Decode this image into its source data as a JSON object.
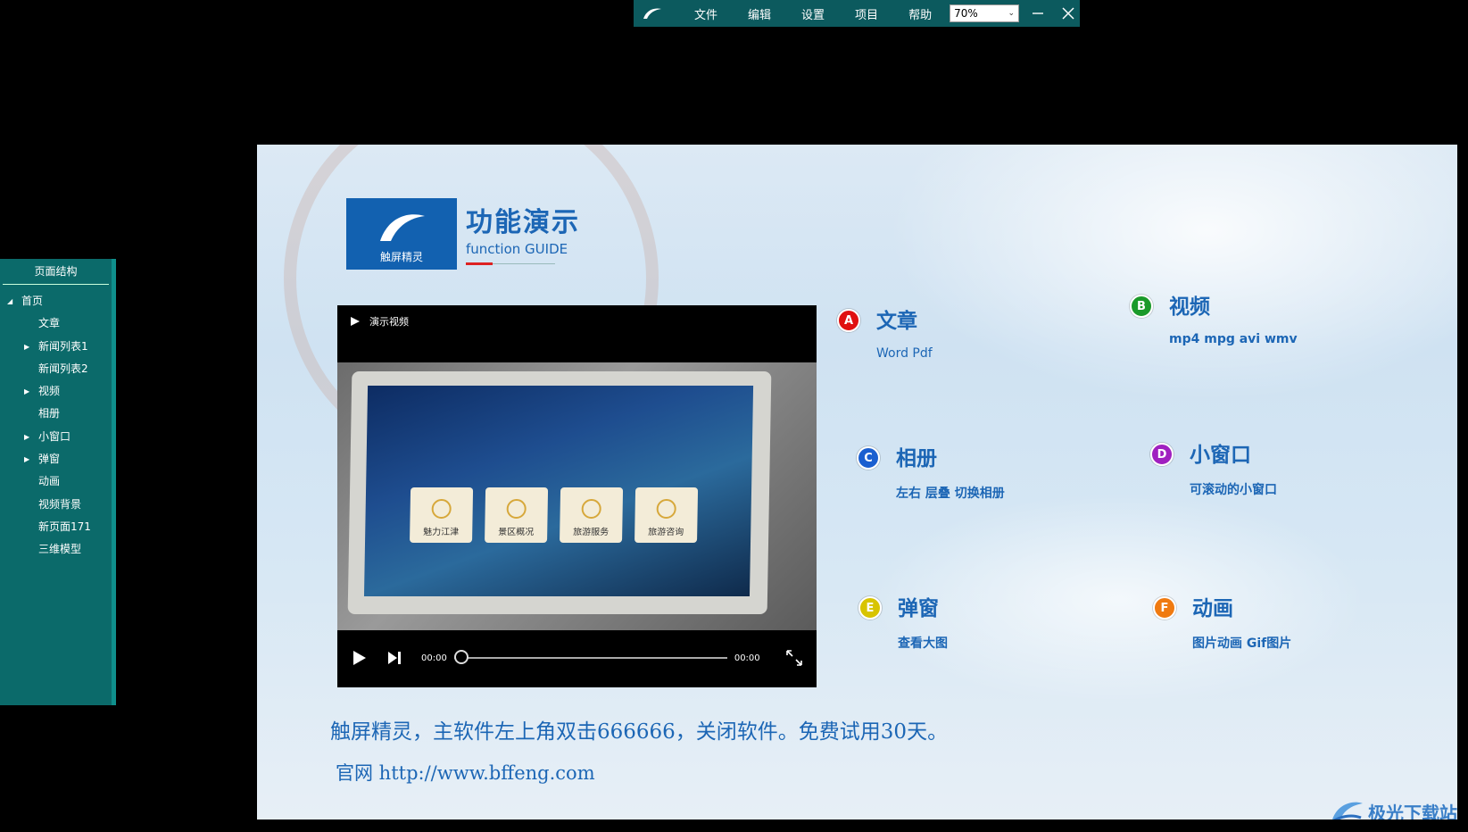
{
  "menubar": {
    "items": [
      "文件",
      "编辑",
      "设置",
      "项目",
      "帮助"
    ],
    "zoom": "70%"
  },
  "sidepanel": {
    "title": "页面结构",
    "tree": [
      {
        "label": "首页",
        "level": 0,
        "expandable": true
      },
      {
        "label": "文章",
        "level": 1,
        "expandable": false
      },
      {
        "label": "新闻列表1",
        "level": 1,
        "expandable": true
      },
      {
        "label": "新闻列表2",
        "level": 1,
        "expandable": false
      },
      {
        "label": "视频",
        "level": 1,
        "expandable": true
      },
      {
        "label": "相册",
        "level": 1,
        "expandable": false
      },
      {
        "label": "小窗口",
        "level": 1,
        "expandable": true
      },
      {
        "label": "弹窗",
        "level": 1,
        "expandable": true
      },
      {
        "label": "动画",
        "level": 1,
        "expandable": false
      },
      {
        "label": "视频背景",
        "level": 1,
        "expandable": false
      },
      {
        "label": "新页面171",
        "level": 1,
        "expandable": false
      },
      {
        "label": "三维模型",
        "level": 1,
        "expandable": false
      }
    ]
  },
  "page": {
    "brand_label": "触屏精灵",
    "title": "功能演示",
    "subtitle": "function GUIDE",
    "video": {
      "title": "演示视频",
      "tiles": [
        "魅力江津",
        "景区概况",
        "旅游服务",
        "旅游咨询"
      ],
      "time_current": "00:00",
      "time_total": "00:00"
    },
    "features": [
      {
        "badge": "A",
        "title": "文章",
        "desc": "Word  Pdf",
        "color": "#e01010"
      },
      {
        "badge": "B",
        "title": "视频",
        "desc": "mp4  mpg  avi  wmv",
        "color": "#1a9a2a"
      },
      {
        "badge": "C",
        "title": "相册",
        "desc": "左右 层叠 切换相册",
        "color": "#1a5fd0"
      },
      {
        "badge": "D",
        "title": "小窗口",
        "desc": "可滚动的小窗口",
        "color": "#a020c0"
      },
      {
        "badge": "E",
        "title": "弹窗",
        "desc": "查看大图",
        "color": "#d8c400"
      },
      {
        "badge": "F",
        "title": "动画",
        "desc": "图片动画  Gif图片",
        "color": "#f07a10"
      }
    ],
    "footer_line1": "触屏精灵，主软件左上角双击666666，关闭软件。免费试用30天。",
    "footer_line2": "官网 http://www.bffeng.com"
  },
  "watermark": "极光下载站",
  "colors": {
    "menubar": "#0c5a5e",
    "sidepanel": "#0b6a6a",
    "accent": "#1c66b5"
  }
}
